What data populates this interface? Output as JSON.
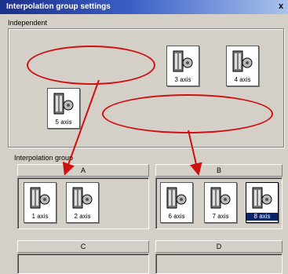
{
  "window": {
    "title": "Interpolation group settings",
    "close_glyph": "x"
  },
  "independent": {
    "label": "Independent",
    "axes": [
      {
        "label": "3 axis"
      },
      {
        "label": "4 axis"
      },
      {
        "label": "5 axis"
      }
    ]
  },
  "interpolation_group": {
    "label": "Interpolation group",
    "groups": [
      {
        "name": "A",
        "axes": [
          {
            "label": "1 axis"
          },
          {
            "label": "2 axis"
          }
        ]
      },
      {
        "name": "B",
        "axes": [
          {
            "label": "6 axis"
          },
          {
            "label": "7 axis"
          },
          {
            "label": "8 axis",
            "selected": true
          }
        ]
      },
      {
        "name": "C",
        "axes": []
      },
      {
        "name": "D",
        "axes": []
      }
    ]
  },
  "annotations": {
    "color": "#d01010"
  }
}
